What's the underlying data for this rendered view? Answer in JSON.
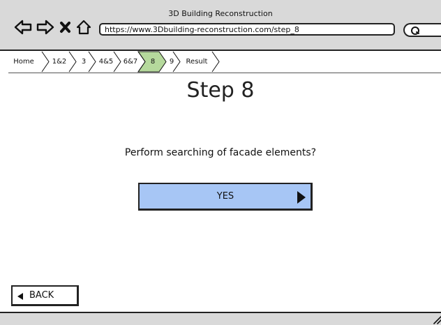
{
  "window": {
    "title": "3D Building Reconstruction"
  },
  "browser": {
    "url": "https://www.3Dbuilding-reconstruction.com/step_8",
    "nav_icons": [
      "arrow-left-icon",
      "arrow-right-icon",
      "close-icon",
      "home-icon"
    ],
    "search_icon": "search-icon"
  },
  "breadcrumb": {
    "items": [
      {
        "label": "Home",
        "active": false
      },
      {
        "label": "1&2",
        "active": false
      },
      {
        "label": "3",
        "active": false
      },
      {
        "label": "4&5",
        "active": false
      },
      {
        "label": "6&7",
        "active": false
      },
      {
        "label": "8",
        "active": true
      },
      {
        "label": "9",
        "active": false
      },
      {
        "label": "Result",
        "active": false
      }
    ],
    "active_color": "#b5d99c"
  },
  "main": {
    "title": "Step 8",
    "question": "Perform searching of facade elements?",
    "yes_button": {
      "label": "YES",
      "color": "#a7c6f5",
      "icon": "play-arrow-icon"
    },
    "back_button": {
      "label": "BACK",
      "icon": "back-arrow-icon"
    }
  }
}
